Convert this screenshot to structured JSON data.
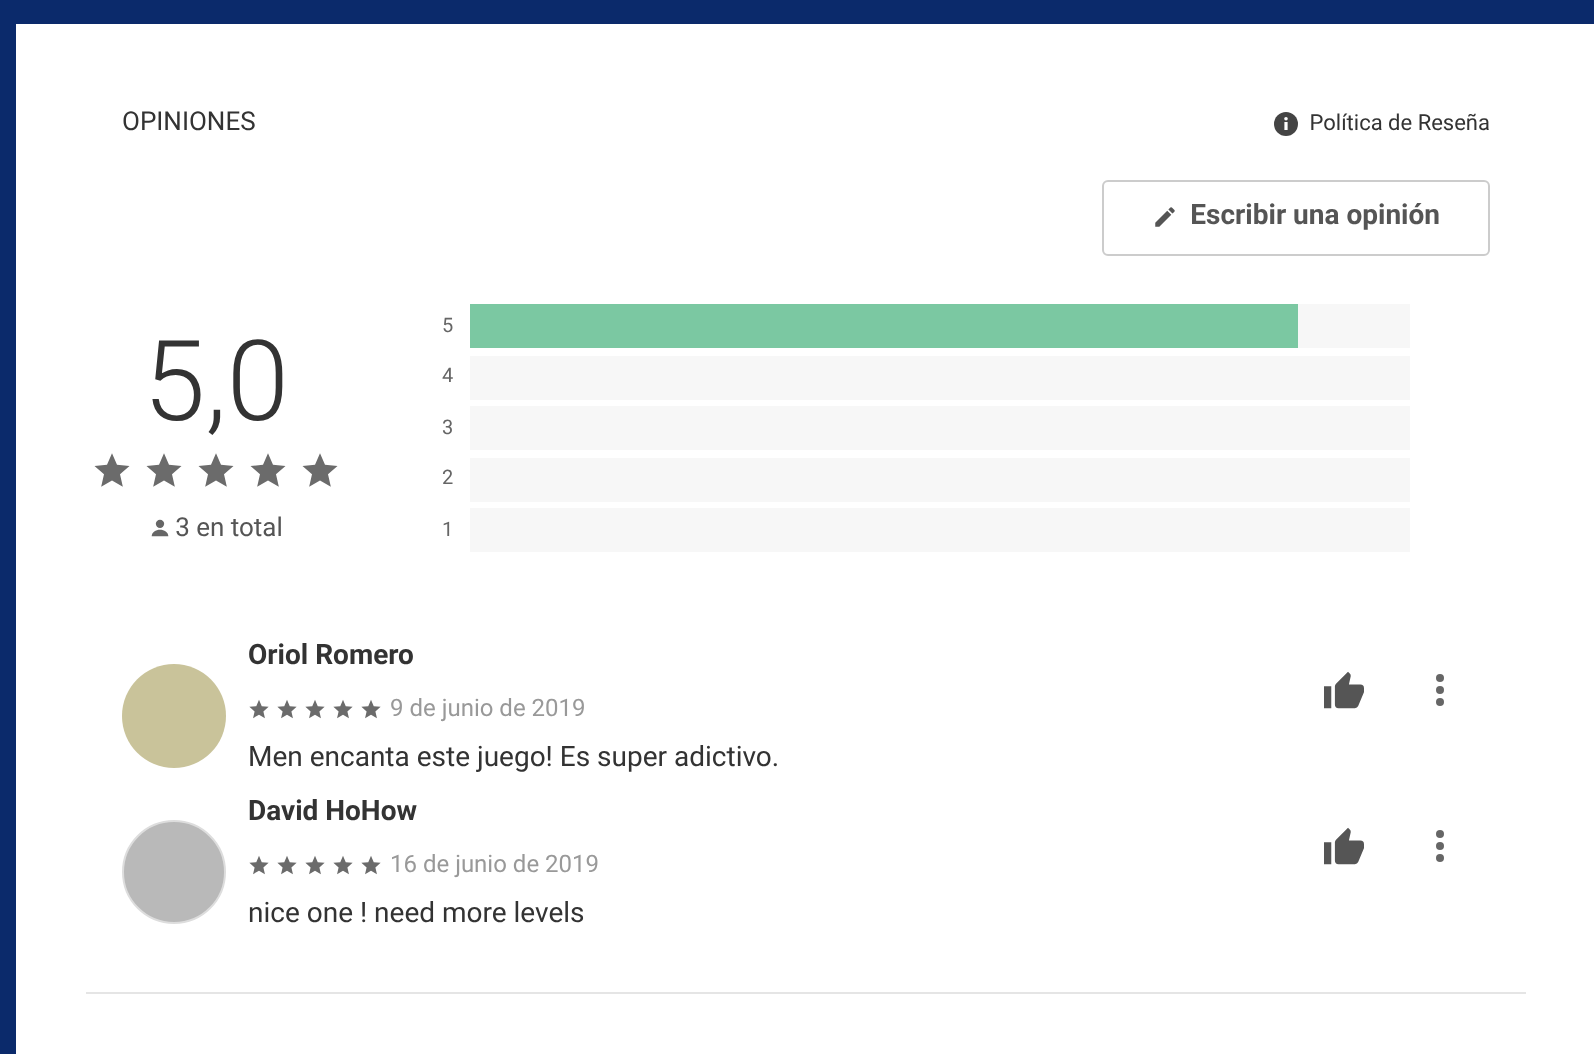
{
  "section_title": "OPINIONES",
  "policy_link": "Política de Reseña",
  "write_button": "Escribir una opinión",
  "summary": {
    "score": "5,0",
    "stars": 5,
    "total": "3 en total"
  },
  "histogram": [
    {
      "label": "5",
      "level": 0.88
    },
    {
      "label": "4"
    },
    {
      "label": "3"
    },
    {
      "label": "2"
    },
    {
      "label": "1"
    }
  ],
  "reviews": [
    {
      "author": "Oriol Romero",
      "stars": 5,
      "date": "9 de junio de 2019",
      "text": "Men encanta este juego! Es super adictivo.",
      "kind": "logo"
    },
    {
      "author": "David HoHow",
      "stars": 5,
      "date": "16 de junio de 2019",
      "text": "nice one ! need more levels",
      "kind": "photo"
    }
  ]
}
